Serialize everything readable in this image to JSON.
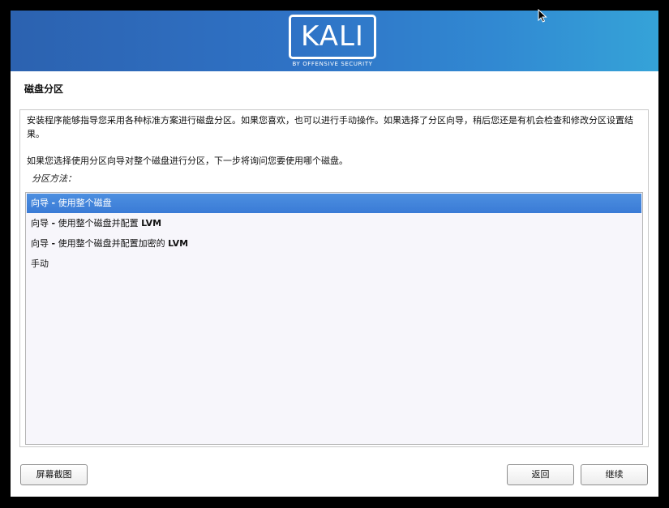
{
  "header": {
    "logo_text": "KALI",
    "logo_subtitle": "BY OFFENSIVE SECURITY"
  },
  "page": {
    "title": "磁盘分区",
    "description": "安装程序能够指导您采用各种标准方案进行磁盘分区。如果您喜欢，也可以进行手动操作。如果选择了分区向导，稍后您还是有机会检查和修改分区设置结果。",
    "prompt": "如果您选择使用分区向导对整个磁盘进行分区，下一步将询问您要使用哪个磁盘。",
    "field_label": "分区方法："
  },
  "options": [
    {
      "prefix": "向导",
      "dash": "-",
      "text": "使用整个磁盘",
      "suffix": "",
      "selected": true
    },
    {
      "prefix": "向导",
      "dash": "-",
      "text": "使用整个磁盘并配置",
      "suffix": "LVM",
      "selected": false
    },
    {
      "prefix": "向导",
      "dash": "-",
      "text": "使用整个磁盘并配置加密的",
      "suffix": "LVM",
      "selected": false
    },
    {
      "prefix": "手动",
      "dash": "",
      "text": "",
      "suffix": "",
      "selected": false
    }
  ],
  "buttons": {
    "screenshot": "屏幕截图",
    "back": "返回",
    "continue": "继续"
  },
  "colors": {
    "selection": "#3a7bd6",
    "banner_start": "#2c62b0",
    "banner_end": "#35a3d8"
  }
}
